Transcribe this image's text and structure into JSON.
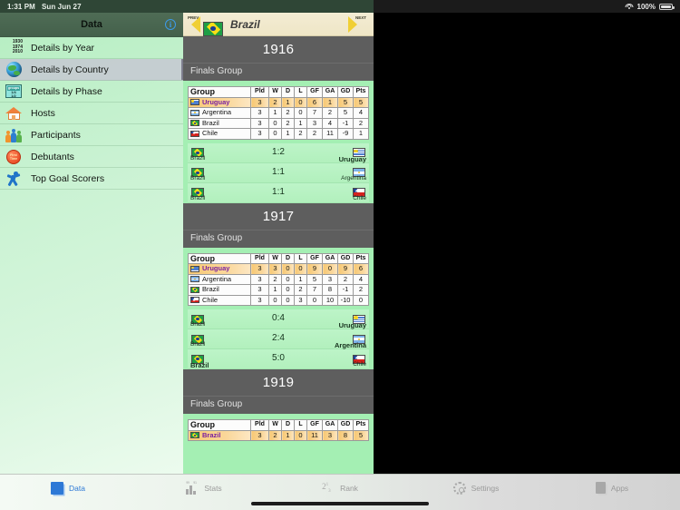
{
  "statusbar": {
    "time": "1:31 PM",
    "date": "Sun Jun 27",
    "battery": "100%",
    "wifi_icon": "wifi-icon",
    "battery_icon": "battery-icon"
  },
  "sidebar": {
    "title": "Data",
    "info_label": "i",
    "items": [
      {
        "label": "Details by Year",
        "icon": "years-icon",
        "selected": false,
        "years": [
          "1930",
          "1974",
          "2010"
        ]
      },
      {
        "label": "Details by Country",
        "icon": "globe-icon",
        "selected": true
      },
      {
        "label": "Details by Phase",
        "icon": "phase-icon",
        "selected": false,
        "phase_text": [
          "groups",
          "1/4",
          "1/2"
        ]
      },
      {
        "label": "Hosts",
        "icon": "house-icon",
        "selected": false
      },
      {
        "label": "Participants",
        "icon": "people-icon",
        "selected": false
      },
      {
        "label": "Debutants",
        "icon": "first-time-icon",
        "selected": false,
        "badge_text": "First Time"
      },
      {
        "label": "Top Goal Scorers",
        "icon": "runner-icon",
        "selected": false
      }
    ]
  },
  "detail": {
    "nav": {
      "prev_label": "PREV",
      "next_label": "NEXT",
      "country": "Brazil",
      "flag": "brazil",
      "prev_icon": "arrow-left-icon",
      "next_icon": "arrow-right-icon"
    },
    "table_headers": [
      "Group",
      "Pld",
      "W",
      "D",
      "L",
      "GF",
      "GA",
      "GD",
      "Pts"
    ],
    "sections": [
      {
        "year": "1916",
        "phase": "Finals Group",
        "standings": [
          {
            "flag": "uruguay",
            "team": "Uruguay",
            "pld": "3",
            "w": "2",
            "d": "1",
            "l": "0",
            "gf": "6",
            "ga": "1",
            "gd": "5",
            "pts": "5",
            "rank1": true
          },
          {
            "flag": "argentina",
            "team": "Argentina",
            "pld": "3",
            "w": "1",
            "d": "2",
            "l": "0",
            "gf": "7",
            "ga": "2",
            "gd": "5",
            "pts": "4",
            "rank1": false
          },
          {
            "flag": "brazil",
            "team": "Brazil",
            "pld": "3",
            "w": "0",
            "d": "2",
            "l": "1",
            "gf": "3",
            "ga": "4",
            "gd": "-1",
            "pts": "2",
            "rank1": false
          },
          {
            "flag": "chile",
            "team": "Chile",
            "pld": "3",
            "w": "0",
            "d": "1",
            "l": "2",
            "gf": "2",
            "ga": "11",
            "gd": "-9",
            "pts": "1",
            "rank1": false
          }
        ],
        "matches": [
          {
            "home_flag": "brazil",
            "home": "Brazil",
            "score": "1:2",
            "away_flag": "uruguay",
            "away": "Uruguay",
            "bold": "away"
          },
          {
            "home_flag": "brazil",
            "home": "Brazil",
            "score": "1:1",
            "away_flag": "argentina",
            "away": "Argentina",
            "bold": "none"
          },
          {
            "home_flag": "brazil",
            "home": "Brazil",
            "score": "1:1",
            "away_flag": "chile",
            "away": "Chile",
            "bold": "none"
          }
        ]
      },
      {
        "year": "1917",
        "phase": "Finals Group",
        "standings": [
          {
            "flag": "uruguay",
            "team": "Uruguay",
            "pld": "3",
            "w": "3",
            "d": "0",
            "l": "0",
            "gf": "9",
            "ga": "0",
            "gd": "9",
            "pts": "6",
            "rank1": true
          },
          {
            "flag": "argentina",
            "team": "Argentina",
            "pld": "3",
            "w": "2",
            "d": "0",
            "l": "1",
            "gf": "5",
            "ga": "3",
            "gd": "2",
            "pts": "4",
            "rank1": false
          },
          {
            "flag": "brazil",
            "team": "Brazil",
            "pld": "3",
            "w": "1",
            "d": "0",
            "l": "2",
            "gf": "7",
            "ga": "8",
            "gd": "-1",
            "pts": "2",
            "rank1": false
          },
          {
            "flag": "chile",
            "team": "Chile",
            "pld": "3",
            "w": "0",
            "d": "0",
            "l": "3",
            "gf": "0",
            "ga": "10",
            "gd": "-10",
            "pts": "0",
            "rank1": false
          }
        ],
        "matches": [
          {
            "home_flag": "brazil",
            "home": "Brazil",
            "score": "0:4",
            "away_flag": "uruguay",
            "away": "Uruguay",
            "bold": "away"
          },
          {
            "home_flag": "brazil",
            "home": "Brazil",
            "score": "2:4",
            "away_flag": "argentina",
            "away": "Argentina",
            "bold": "away"
          },
          {
            "home_flag": "brazil",
            "home": "Brazil",
            "score": "5:0",
            "away_flag": "chile",
            "away": "Chile",
            "bold": "home"
          }
        ]
      },
      {
        "year": "1919",
        "phase": "Finals Group",
        "standings": [
          {
            "flag": "brazil",
            "team": "Brazil",
            "pld": "3",
            "w": "2",
            "d": "1",
            "l": "0",
            "gf": "11",
            "ga": "3",
            "gd": "8",
            "pts": "5",
            "rank1": true
          }
        ],
        "matches": []
      }
    ]
  },
  "tabbar": {
    "tabs": [
      {
        "label": "Data",
        "icon": "data-icon",
        "active": true
      },
      {
        "label": "Stats",
        "icon": "stats-icon",
        "active": false
      },
      {
        "label": "Rank",
        "icon": "rank-icon",
        "active": false
      },
      {
        "label": "Settings",
        "icon": "gear-icon",
        "active": false
      },
      {
        "label": "Apps",
        "icon": "apps-icon",
        "active": false
      }
    ]
  },
  "colors": {
    "sidebar_green": "#c9f2d2",
    "detail_green": "#a4efb3",
    "header_grey": "#5e5e5e",
    "nav_cream": "#efe6c6",
    "accent_blue": "#2d79d6",
    "rank1_gold": "#f7c873"
  }
}
